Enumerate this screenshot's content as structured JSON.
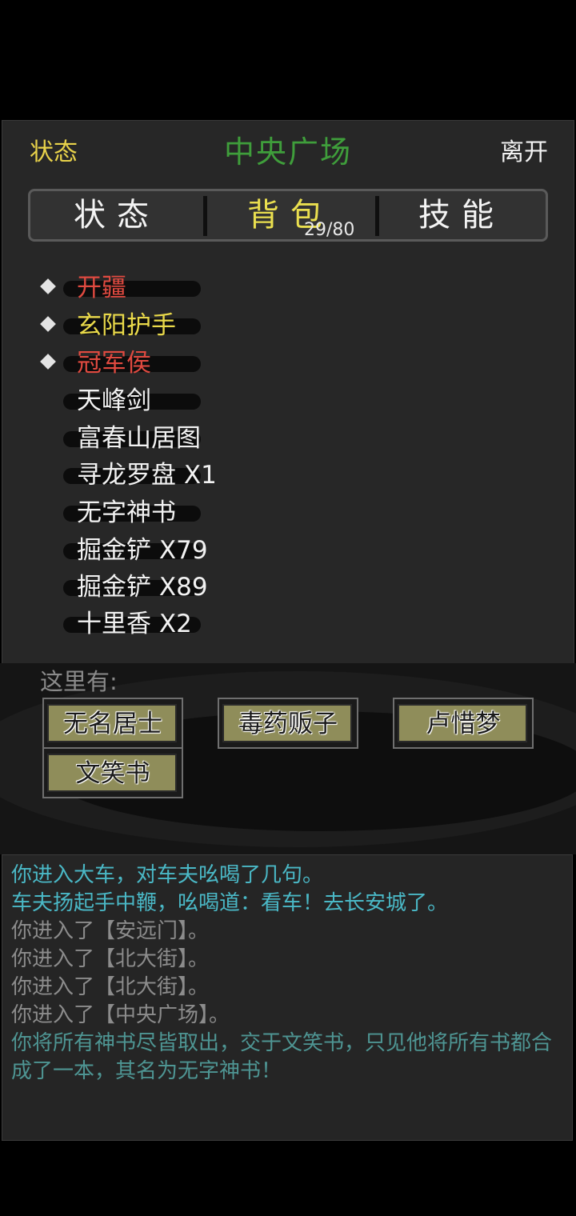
{
  "header": {
    "left_label": "状态",
    "title": "中央广场",
    "right_label": "离开"
  },
  "tabs": [
    {
      "label": "状态",
      "active": false
    },
    {
      "label": "背包",
      "active": true,
      "badge": "29/80"
    },
    {
      "label": "技能",
      "active": false
    }
  ],
  "inventory": [
    {
      "name": "开疆",
      "marked": true,
      "color": "red"
    },
    {
      "name": "玄阳护手",
      "marked": true,
      "color": "yellow"
    },
    {
      "name": "冠军侯",
      "marked": true,
      "color": "red"
    },
    {
      "name": "天峰剑",
      "marked": false,
      "color": "white"
    },
    {
      "name": "富春山居图",
      "marked": false,
      "color": "white"
    },
    {
      "name": "寻龙罗盘 X1",
      "marked": false,
      "color": "white"
    },
    {
      "name": "无字神书",
      "marked": false,
      "color": "white"
    },
    {
      "name": "掘金铲 X79",
      "marked": false,
      "color": "white"
    },
    {
      "name": "掘金铲 X89",
      "marked": false,
      "color": "white"
    },
    {
      "name": "十里香 X2",
      "marked": false,
      "color": "white"
    }
  ],
  "here": {
    "label": "这里有:",
    "npcs": [
      "无名居士",
      "毒药贩子",
      "卢惜梦",
      "文笑书"
    ]
  },
  "log": [
    {
      "text": "你进入大车，对车夫吆喝了几句。",
      "color": "cyan"
    },
    {
      "text": "车夫扬起手中鞭，吆喝道：看车！去长安城了。",
      "color": "cyan"
    },
    {
      "text": "你进入了【安远门】。",
      "color": "grey"
    },
    {
      "text": "你进入了【北大街】。",
      "color": "grey"
    },
    {
      "text": "你进入了【北大街】。",
      "color": "grey"
    },
    {
      "text": "你进入了【中央广场】。",
      "color": "grey"
    },
    {
      "text": "你将所有神书尽皆取出，交于文笑书，只见他将所有书都合成了一本，其名为无字神书！",
      "color": "teal"
    }
  ],
  "colors": {
    "accent_yellow": "#e9d94a",
    "title_green": "#3f9e3b",
    "item_red": "#e04a40",
    "log_cyan": "#4ab8c6",
    "log_grey": "#8c8c8c"
  }
}
